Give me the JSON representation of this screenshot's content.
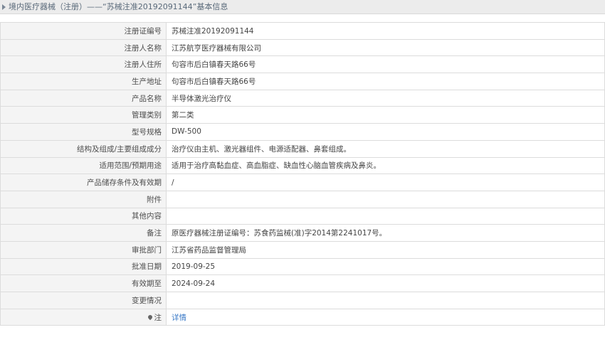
{
  "header": {
    "title": "境内医疗器械（注册）——“苏械注准20192091144”基本信息"
  },
  "rows": [
    {
      "label": "注册证编号",
      "value": "苏械注准20192091144"
    },
    {
      "label": "注册人名称",
      "value": "江苏航亨医疗器械有限公司"
    },
    {
      "label": "注册人住所",
      "value": "句容市后白镇春天路66号"
    },
    {
      "label": "生产地址",
      "value": "句容市后白镇春天路66号"
    },
    {
      "label": "产品名称",
      "value": "半导体激光治疗仪"
    },
    {
      "label": "管理类别",
      "value": "第二类"
    },
    {
      "label": "型号规格",
      "value": "DW-500"
    },
    {
      "label": "结构及组成/主要组成成分",
      "value": "治疗仪由主机、激光器组件、电源适配器、鼻套组成。"
    },
    {
      "label": "适用范围/预期用途",
      "value": "适用于治疗高黏血症、高血脂症、缺血性心脑血管疾病及鼻炎。"
    },
    {
      "label": "产品储存条件及有效期",
      "value": "/"
    },
    {
      "label": "附件",
      "value": ""
    },
    {
      "label": "其他内容",
      "value": ""
    },
    {
      "label": "备注",
      "value": "原医疗器械注册证编号：苏食药监械(准)字2014第2241017号。"
    },
    {
      "label": "审批部门",
      "value": "江苏省药品监督管理局"
    },
    {
      "label": "批准日期",
      "value": "2019-09-25"
    },
    {
      "label": "有效期至",
      "value": "2024-09-24"
    },
    {
      "label": "变更情况",
      "value": ""
    },
    {
      "label": "注",
      "value": "详情"
    }
  ],
  "icons": {
    "header": "triangle-right-icon",
    "note": "map-pin-icon"
  },
  "colors": {
    "link": "#3c7bc8",
    "header_bg": "#ececec",
    "label_bg": "#f4f4f4"
  }
}
